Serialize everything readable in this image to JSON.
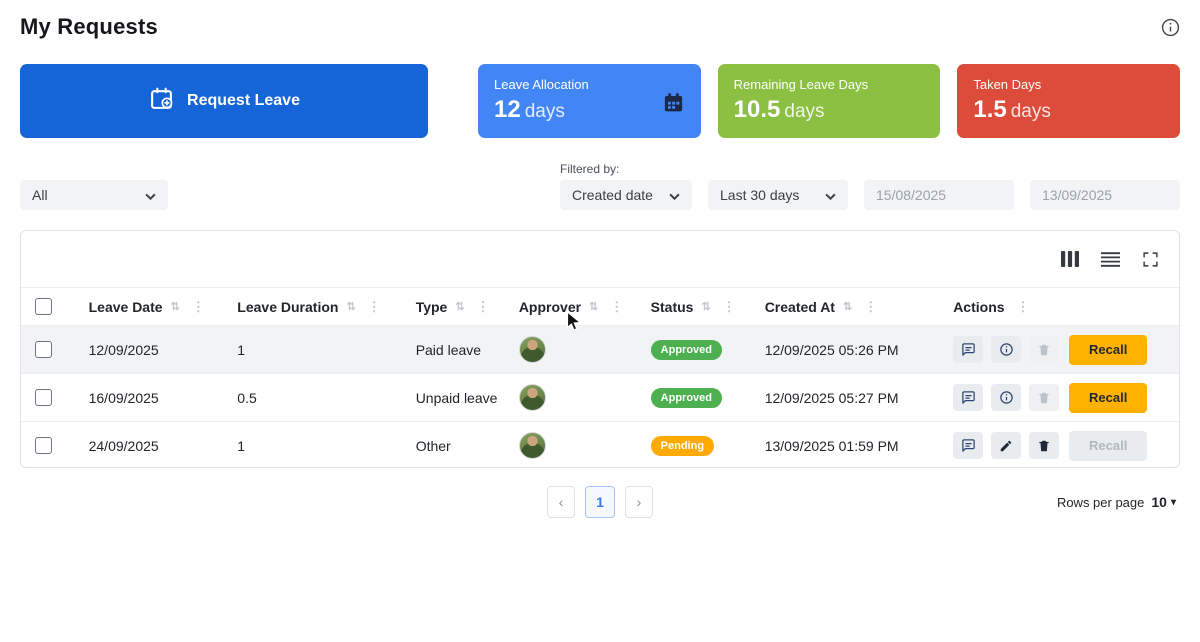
{
  "page": {
    "title": "My Requests"
  },
  "colors": {
    "primary_button": "#1564d8",
    "allocation_card": "#4286f5",
    "remaining_card": "#8bc043",
    "taken_card": "#dd4b3b",
    "recall_button": "#ffb100",
    "approved_pill": "#4caf50",
    "pending_pill": "#ffaa00"
  },
  "actions_bar": {
    "request_leave_label": "Request Leave"
  },
  "stat_cards": [
    {
      "label": "Leave Allocation",
      "value": "12",
      "unit": "days",
      "icon": "calendar-icon"
    },
    {
      "label": "Remaining Leave Days",
      "value": "10.5",
      "unit": "days"
    },
    {
      "label": "Taken Days",
      "value": "1.5",
      "unit": "days"
    }
  ],
  "filters": {
    "scope": "All",
    "filtered_by_label": "Filtered by:",
    "field": "Created date",
    "range": "Last 30 days",
    "date_from": "15/08/2025",
    "date_to": "13/09/2025"
  },
  "table": {
    "columns": {
      "leave_date": "Leave Date",
      "leave_duration": "Leave Duration",
      "type": "Type",
      "approver": "Approver",
      "status": "Status",
      "created_at": "Created At",
      "actions": "Actions"
    },
    "rows": [
      {
        "leave_date": "12/09/2025",
        "leave_duration": "1",
        "type": "Paid leave",
        "status": "Approved",
        "created_at": "12/09/2025 05:26 PM",
        "recall_label": "Recall",
        "recall_enabled": true,
        "delete_enabled": false
      },
      {
        "leave_date": "16/09/2025",
        "leave_duration": "0.5",
        "type": "Unpaid leave",
        "status": "Approved",
        "created_at": "12/09/2025 05:27 PM",
        "recall_label": "Recall",
        "recall_enabled": true,
        "delete_enabled": false
      },
      {
        "leave_date": "24/09/2025",
        "leave_duration": "1",
        "type": "Other",
        "status": "Pending",
        "created_at": "13/09/2025 01:59 PM",
        "recall_label": "Recall",
        "recall_enabled": false,
        "delete_enabled": true
      }
    ]
  },
  "pagination": {
    "prev": "‹",
    "current_page": "1",
    "next": "›",
    "rows_per_page_label": "Rows per page",
    "rows_per_page_value": "10"
  }
}
